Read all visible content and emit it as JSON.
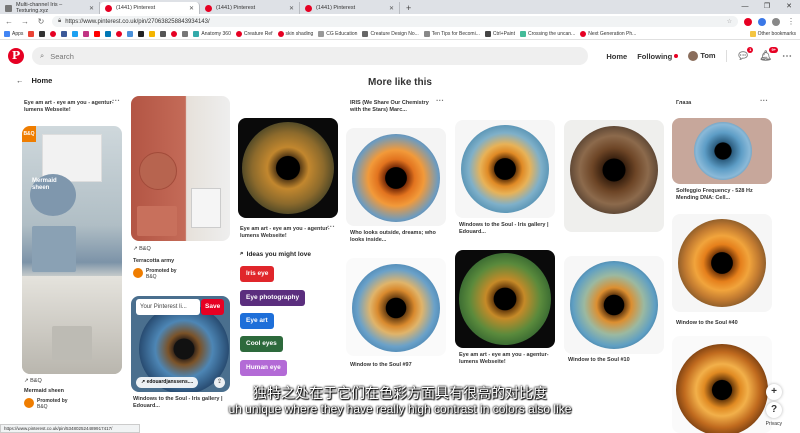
{
  "browser": {
    "tabs": [
      {
        "label": "Multi-channel Iris – Texturing.xyz",
        "active": false
      },
      {
        "label": "(1441) Pinterest",
        "active": true
      },
      {
        "label": "(1441) Pinterest",
        "active": false
      },
      {
        "label": "(1441) Pinterest",
        "active": false
      }
    ],
    "new_tab": "+",
    "url": "https://www.pinterest.co.uk/pin/270638258843934143/",
    "bookmarks": [
      "Apps",
      "Anatomy 360",
      "Creature Ref",
      "skin shading",
      "CG Education",
      "Creature Design No...",
      "Ten Tips for Becomi...",
      "Ctrl+Paint",
      "Crossing the uncan...",
      "Next Generation Ph...",
      "Other bookmarks"
    ],
    "status_url": "https://www.pinterest.co.uk/pin/534802524489917417/"
  },
  "header": {
    "search_placeholder": "Search",
    "home": "Home",
    "following": "Following",
    "user": "Tom",
    "badge_messages": "1",
    "badge_notifications": "9+"
  },
  "page": {
    "back_label": "Home",
    "section_title": "More like this"
  },
  "pins": {
    "col1_title": "Eye am art - eye am you - agentur-lumens Webseite!",
    "bq_label": "B&Q",
    "mermaid_text": "Mermaid sheen",
    "mermaid_title": "Mermaid sheen",
    "promoted_by": "Promoted by",
    "col2_by": "B&Q",
    "col2_title": "Terracotta army",
    "board_select": "Your Pinterest li...",
    "save": "Save",
    "link_pill": "edouardjanssens....",
    "col2_bottom_title": "Windows to the Soul - Iris gallery | Edouard...",
    "col3_title": "Eye am art - eye am you - agentur-lumens Webseite!",
    "col4_top_title": "IRIS (We Share Our Chemistry with the Stars) Marc...",
    "col4_mid_title": "Who looks outside, dreams; who looks inside...",
    "col4_bottom_title": "Window to the Soul #97",
    "col5_mid_title": "Windows to the Soul - Iris gallery | Edouard...",
    "col5_bottom_title": "Eye am art - eye am you - agentur-lumens Webseite!",
    "col6_bottom_title": "Window to the Soul #10",
    "col7_top_title": "Глаза",
    "col7_mid_title": "Solfeggio Frequency - 528 Hz Mending DNA: Cell...",
    "col7_bottom_title": "Window to the Soul #40"
  },
  "ideas": {
    "header": "Ideas you might love",
    "chips": [
      {
        "label": "Iris eye",
        "color": "#e0262b"
      },
      {
        "label": "Eye photography",
        "color": "#5b2e7e"
      },
      {
        "label": "Eye art",
        "color": "#1e6fd9"
      },
      {
        "label": "Cool eyes",
        "color": "#2d6a3c"
      },
      {
        "label": "Human eye",
        "color": "#b36ad6"
      }
    ]
  },
  "subtitles": {
    "chinese": "独特之处在于它们在色彩方面具有很高的对比度",
    "english": "uh unique where they have really high contrast in colors also like"
  },
  "misc": {
    "privacy": "Privacy",
    "plus": "+",
    "help": "?"
  },
  "colors": {
    "pinterest_red": "#e60023"
  }
}
